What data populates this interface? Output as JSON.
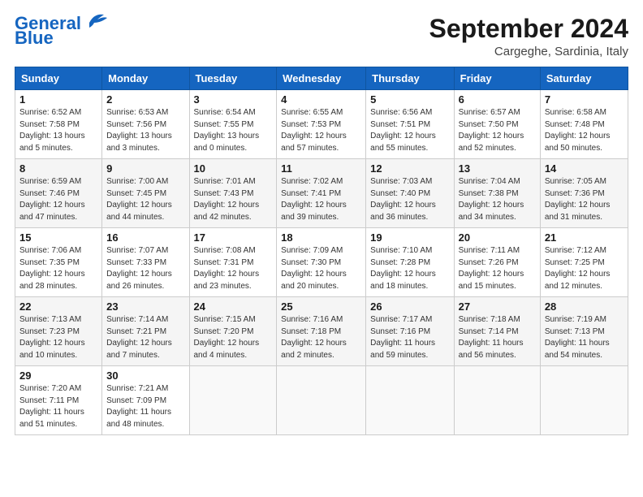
{
  "header": {
    "logo_line1": "General",
    "logo_line2": "Blue",
    "month": "September 2024",
    "location": "Cargeghe, Sardinia, Italy"
  },
  "days_of_week": [
    "Sunday",
    "Monday",
    "Tuesday",
    "Wednesday",
    "Thursday",
    "Friday",
    "Saturday"
  ],
  "weeks": [
    [
      {
        "num": "1",
        "sunrise": "Sunrise: 6:52 AM",
        "sunset": "Sunset: 7:58 PM",
        "daylight": "Daylight: 13 hours and 5 minutes."
      },
      {
        "num": "2",
        "sunrise": "Sunrise: 6:53 AM",
        "sunset": "Sunset: 7:56 PM",
        "daylight": "Daylight: 13 hours and 3 minutes."
      },
      {
        "num": "3",
        "sunrise": "Sunrise: 6:54 AM",
        "sunset": "Sunset: 7:55 PM",
        "daylight": "Daylight: 13 hours and 0 minutes."
      },
      {
        "num": "4",
        "sunrise": "Sunrise: 6:55 AM",
        "sunset": "Sunset: 7:53 PM",
        "daylight": "Daylight: 12 hours and 57 minutes."
      },
      {
        "num": "5",
        "sunrise": "Sunrise: 6:56 AM",
        "sunset": "Sunset: 7:51 PM",
        "daylight": "Daylight: 12 hours and 55 minutes."
      },
      {
        "num": "6",
        "sunrise": "Sunrise: 6:57 AM",
        "sunset": "Sunset: 7:50 PM",
        "daylight": "Daylight: 12 hours and 52 minutes."
      },
      {
        "num": "7",
        "sunrise": "Sunrise: 6:58 AM",
        "sunset": "Sunset: 7:48 PM",
        "daylight": "Daylight: 12 hours and 50 minutes."
      }
    ],
    [
      {
        "num": "8",
        "sunrise": "Sunrise: 6:59 AM",
        "sunset": "Sunset: 7:46 PM",
        "daylight": "Daylight: 12 hours and 47 minutes."
      },
      {
        "num": "9",
        "sunrise": "Sunrise: 7:00 AM",
        "sunset": "Sunset: 7:45 PM",
        "daylight": "Daylight: 12 hours and 44 minutes."
      },
      {
        "num": "10",
        "sunrise": "Sunrise: 7:01 AM",
        "sunset": "Sunset: 7:43 PM",
        "daylight": "Daylight: 12 hours and 42 minutes."
      },
      {
        "num": "11",
        "sunrise": "Sunrise: 7:02 AM",
        "sunset": "Sunset: 7:41 PM",
        "daylight": "Daylight: 12 hours and 39 minutes."
      },
      {
        "num": "12",
        "sunrise": "Sunrise: 7:03 AM",
        "sunset": "Sunset: 7:40 PM",
        "daylight": "Daylight: 12 hours and 36 minutes."
      },
      {
        "num": "13",
        "sunrise": "Sunrise: 7:04 AM",
        "sunset": "Sunset: 7:38 PM",
        "daylight": "Daylight: 12 hours and 34 minutes."
      },
      {
        "num": "14",
        "sunrise": "Sunrise: 7:05 AM",
        "sunset": "Sunset: 7:36 PM",
        "daylight": "Daylight: 12 hours and 31 minutes."
      }
    ],
    [
      {
        "num": "15",
        "sunrise": "Sunrise: 7:06 AM",
        "sunset": "Sunset: 7:35 PM",
        "daylight": "Daylight: 12 hours and 28 minutes."
      },
      {
        "num": "16",
        "sunrise": "Sunrise: 7:07 AM",
        "sunset": "Sunset: 7:33 PM",
        "daylight": "Daylight: 12 hours and 26 minutes."
      },
      {
        "num": "17",
        "sunrise": "Sunrise: 7:08 AM",
        "sunset": "Sunset: 7:31 PM",
        "daylight": "Daylight: 12 hours and 23 minutes."
      },
      {
        "num": "18",
        "sunrise": "Sunrise: 7:09 AM",
        "sunset": "Sunset: 7:30 PM",
        "daylight": "Daylight: 12 hours and 20 minutes."
      },
      {
        "num": "19",
        "sunrise": "Sunrise: 7:10 AM",
        "sunset": "Sunset: 7:28 PM",
        "daylight": "Daylight: 12 hours and 18 minutes."
      },
      {
        "num": "20",
        "sunrise": "Sunrise: 7:11 AM",
        "sunset": "Sunset: 7:26 PM",
        "daylight": "Daylight: 12 hours and 15 minutes."
      },
      {
        "num": "21",
        "sunrise": "Sunrise: 7:12 AM",
        "sunset": "Sunset: 7:25 PM",
        "daylight": "Daylight: 12 hours and 12 minutes."
      }
    ],
    [
      {
        "num": "22",
        "sunrise": "Sunrise: 7:13 AM",
        "sunset": "Sunset: 7:23 PM",
        "daylight": "Daylight: 12 hours and 10 minutes."
      },
      {
        "num": "23",
        "sunrise": "Sunrise: 7:14 AM",
        "sunset": "Sunset: 7:21 PM",
        "daylight": "Daylight: 12 hours and 7 minutes."
      },
      {
        "num": "24",
        "sunrise": "Sunrise: 7:15 AM",
        "sunset": "Sunset: 7:20 PM",
        "daylight": "Daylight: 12 hours and 4 minutes."
      },
      {
        "num": "25",
        "sunrise": "Sunrise: 7:16 AM",
        "sunset": "Sunset: 7:18 PM",
        "daylight": "Daylight: 12 hours and 2 minutes."
      },
      {
        "num": "26",
        "sunrise": "Sunrise: 7:17 AM",
        "sunset": "Sunset: 7:16 PM",
        "daylight": "Daylight: 11 hours and 59 minutes."
      },
      {
        "num": "27",
        "sunrise": "Sunrise: 7:18 AM",
        "sunset": "Sunset: 7:14 PM",
        "daylight": "Daylight: 11 hours and 56 minutes."
      },
      {
        "num": "28",
        "sunrise": "Sunrise: 7:19 AM",
        "sunset": "Sunset: 7:13 PM",
        "daylight": "Daylight: 11 hours and 54 minutes."
      }
    ],
    [
      {
        "num": "29",
        "sunrise": "Sunrise: 7:20 AM",
        "sunset": "Sunset: 7:11 PM",
        "daylight": "Daylight: 11 hours and 51 minutes."
      },
      {
        "num": "30",
        "sunrise": "Sunrise: 7:21 AM",
        "sunset": "Sunset: 7:09 PM",
        "daylight": "Daylight: 11 hours and 48 minutes."
      },
      null,
      null,
      null,
      null,
      null
    ]
  ]
}
